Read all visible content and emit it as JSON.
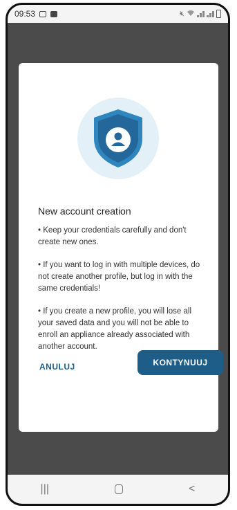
{
  "status_bar": {
    "time": "09:53",
    "left_icons": [
      "image-icon",
      "notification-icon"
    ],
    "right_icons": [
      "mute-icon",
      "wifi-icon",
      "signal-icon",
      "signal-icon",
      "battery-icon"
    ]
  },
  "dialog": {
    "icon": "shield-user-icon",
    "title": "New account creation",
    "bullets": [
      "• Keep your credentials carefully and don't create new ones.",
      "• If you want to log in with multiple devices, do not create another profile, but log in with the same credentials!",
      "• If you create a new profile, you will lose all your saved data and you will not be able to enroll an appliance already associated with another account."
    ],
    "cancel_label": "ANULUJ",
    "continue_label": "KONTYNUUJ"
  },
  "nav_bar": {
    "recent_label": "|||",
    "back_label": "<"
  },
  "colors": {
    "accent": "#1e5d87",
    "shield": "#2f86bf",
    "overlay": "#4b4b4b"
  }
}
